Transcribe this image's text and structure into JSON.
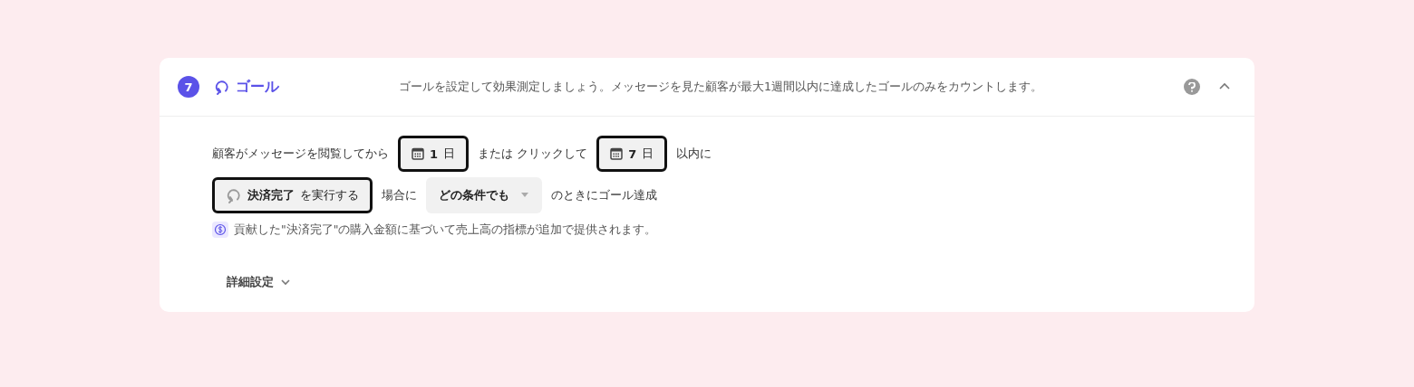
{
  "section": {
    "step": "7",
    "title": "ゴール",
    "description": "ゴールを設定して効果測定しましょう。メッセージを見た顧客が最大1週間以内に達成したゴールのみをカウントします。",
    "expanded": true
  },
  "rows": [
    [
      {
        "kind": "text",
        "text": "顧客がメッセージを閲覧してから"
      },
      {
        "kind": "date",
        "value": "1",
        "unit": "日"
      },
      {
        "kind": "text",
        "text": "または クリックして"
      },
      {
        "kind": "date",
        "value": "7",
        "unit": "日"
      },
      {
        "kind": "text",
        "text": "以内に"
      }
    ],
    [
      {
        "kind": "event",
        "value": "決済完了",
        "suffix": "を実行する"
      },
      {
        "kind": "text",
        "text": "場合に"
      },
      {
        "kind": "dropdown",
        "value": "どの条件でも"
      },
      {
        "kind": "text",
        "text": "のときにゴール達成"
      }
    ]
  ],
  "note": "貢献した\"決済完了\"の購入金額に基づいて売上高の指標が追加で提供されます。",
  "advanced": {
    "label": "詳細設定",
    "expanded": false
  }
}
